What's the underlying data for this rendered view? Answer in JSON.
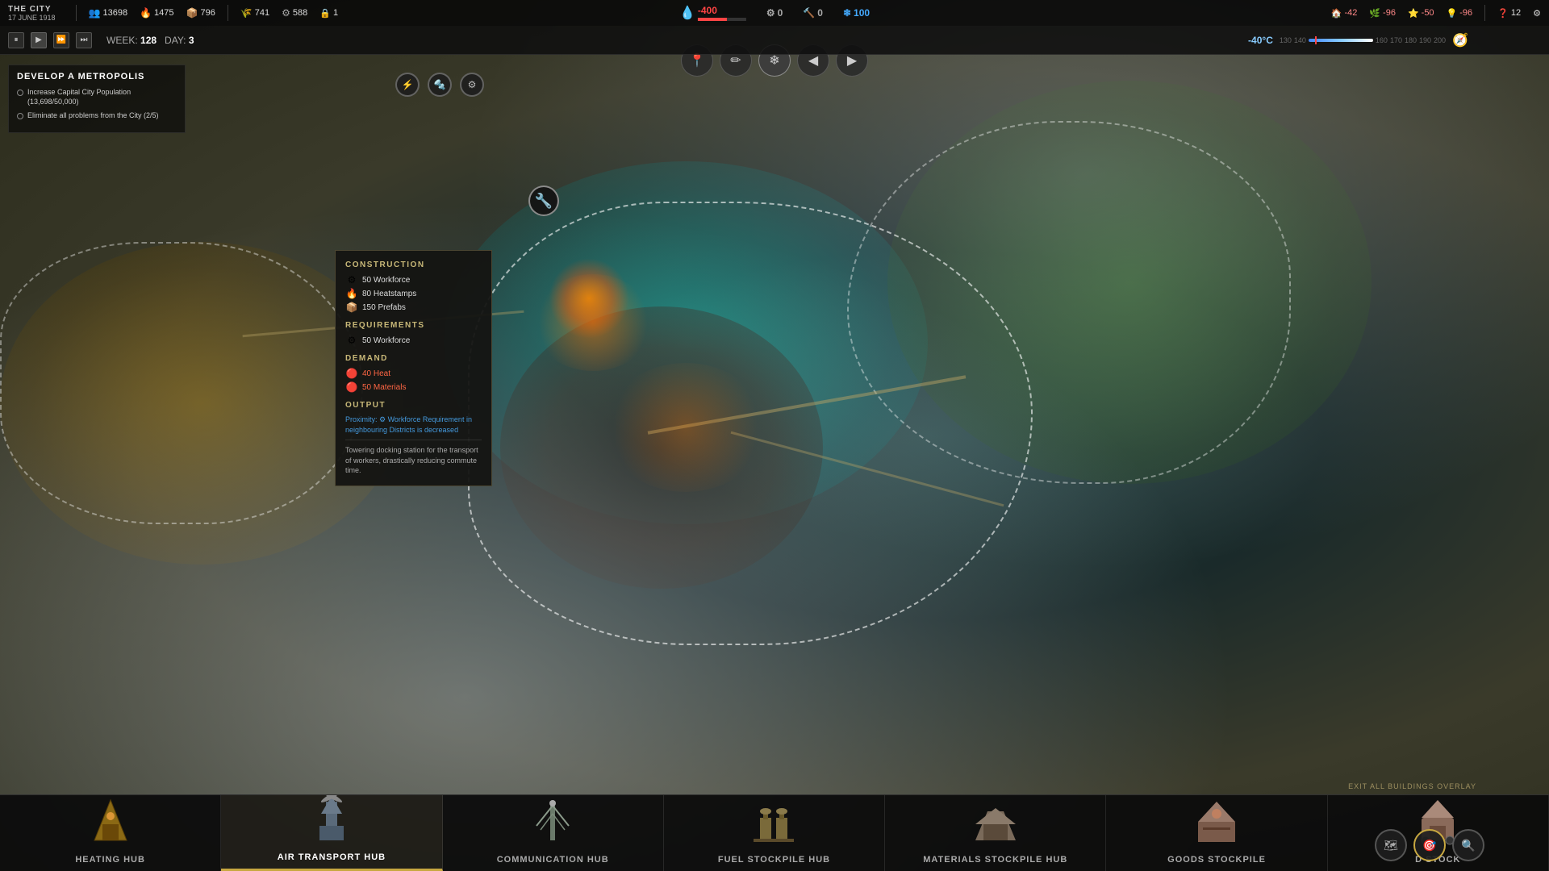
{
  "city": {
    "name": "THE CITY",
    "date": "17 JUNE 1918"
  },
  "top_hud": {
    "population": "13698",
    "pop_icon": "👥",
    "heatstamps": "1475",
    "heatstamps_icon": "🔥",
    "prefabs": "796",
    "prefabs_icon": "📦",
    "food": "741",
    "food_icon": "🌾",
    "materials": "588",
    "materials_icon": "⚙",
    "lock_icon": "🔒",
    "lock_val": "1"
  },
  "center_hud": {
    "heat_val": "-400",
    "pop_val": "0",
    "workforce_val": "0",
    "storm_val": "100"
  },
  "right_hud": {
    "stat1": "-42",
    "stat2": "-96",
    "stat3": "-50",
    "stat4": "-96",
    "questions": "12"
  },
  "timeline": {
    "week": "128",
    "day": "3",
    "temp": "-40°C",
    "temp_values": [
      "130",
      "140",
      "150",
      "160",
      "170",
      "180",
      "190",
      "200"
    ]
  },
  "objectives": {
    "title": "DEVELOP A METROPOLIS",
    "items": [
      {
        "text": "Increase Capital City Population (13,698/50,000)"
      },
      {
        "text": "Eliminate all problems from the City (2/5)"
      }
    ]
  },
  "building_card": {
    "construction_title": "CONSTRUCTION",
    "construction_stats": [
      {
        "icon": "⚙",
        "value": "50 Workforce"
      },
      {
        "icon": "🔥",
        "value": "80 Heatstamps"
      },
      {
        "icon": "📦",
        "value": "150 Prefabs"
      }
    ],
    "requirements_title": "REQUIREMENTS",
    "requirements_stats": [
      {
        "icon": "⚙",
        "value": "50 Workforce"
      }
    ],
    "demand_title": "DEMAND",
    "demand_stats": [
      {
        "icon": "🔴",
        "value": "40 Heat",
        "class": "red"
      },
      {
        "icon": "🔴",
        "value": "50 Materials",
        "class": "red"
      }
    ],
    "output_title": "OUTPUT",
    "output_text": "Proximity: ⚙ Workforce Requirement in neighbouring Districts is decreased",
    "description": "Towering docking station for the transport of workers, drastically reducing commute time."
  },
  "bottom_tabs": [
    {
      "id": "heating-hub",
      "label": "HEATING HUB",
      "active": false
    },
    {
      "id": "air-transport-hub",
      "label": "AIR TRANSPORT HUB",
      "active": true
    },
    {
      "id": "communication-hub",
      "label": "COMMUNICATION HUB",
      "active": false
    },
    {
      "id": "fuel-stockpile-hub",
      "label": "FUEL STOCKPILE HUB",
      "active": false
    },
    {
      "id": "materials-stockpile-hub",
      "label": "MATERIALS STOCKPILE HUB",
      "active": false
    },
    {
      "id": "goods-stockpile",
      "label": "GOODS STOCKPILE",
      "active": false
    },
    {
      "id": "d-stock",
      "label": "D STOCK",
      "active": false
    }
  ],
  "exit_overlay_label": "EXIT ALL BUILDINGS OVERLAY",
  "map_toolbar_icons": [
    "📍",
    "✏️",
    "❄️",
    "◀",
    "▶"
  ],
  "toolbar_highlighted_index": 2
}
